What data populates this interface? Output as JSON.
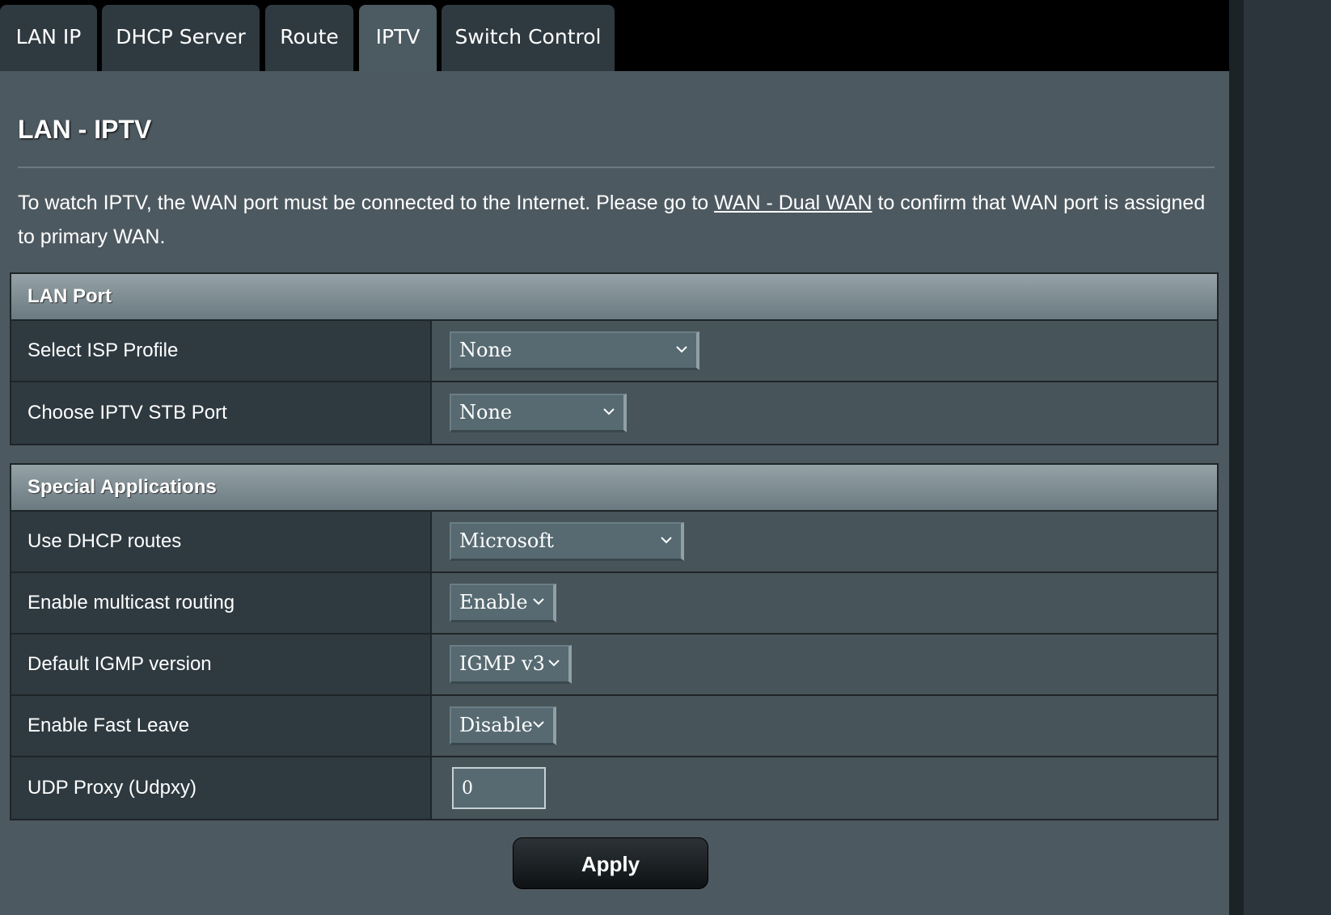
{
  "tabs": [
    {
      "label": "LAN IP",
      "active": false
    },
    {
      "label": "DHCP Server",
      "active": false
    },
    {
      "label": "Route",
      "active": false
    },
    {
      "label": "IPTV",
      "active": true
    },
    {
      "label": "Switch Control",
      "active": false
    }
  ],
  "page": {
    "title": "LAN - IPTV",
    "intro_before": "To watch IPTV, the WAN port must be connected to the Internet. Please go to ",
    "intro_link": "WAN - Dual WAN",
    "intro_after": " to confirm that WAN port is assigned to primary WAN."
  },
  "lan_port": {
    "header": "LAN Port",
    "rows": [
      {
        "label": "Select ISP Profile",
        "value": "None"
      },
      {
        "label": "Choose IPTV STB Port",
        "value": "None"
      }
    ]
  },
  "special_apps": {
    "header": "Special Applications",
    "rows": [
      {
        "label": "Use DHCP routes",
        "value": "Microsoft"
      },
      {
        "label": "Enable multicast routing",
        "value": "Enable"
      },
      {
        "label": "Default IGMP version",
        "value": "IGMP v3"
      },
      {
        "label": "Enable Fast Leave",
        "value": "Disable"
      },
      {
        "label": "UDP Proxy (Udpxy)",
        "value": "0"
      }
    ]
  },
  "actions": {
    "apply_label": "Apply"
  },
  "colors": {
    "panel_bg": "#4d5960",
    "tab_active": "#4c5a61",
    "tab_inactive": "#2f3a40"
  },
  "icons": {
    "dropdown": "chevron-down-icon"
  }
}
